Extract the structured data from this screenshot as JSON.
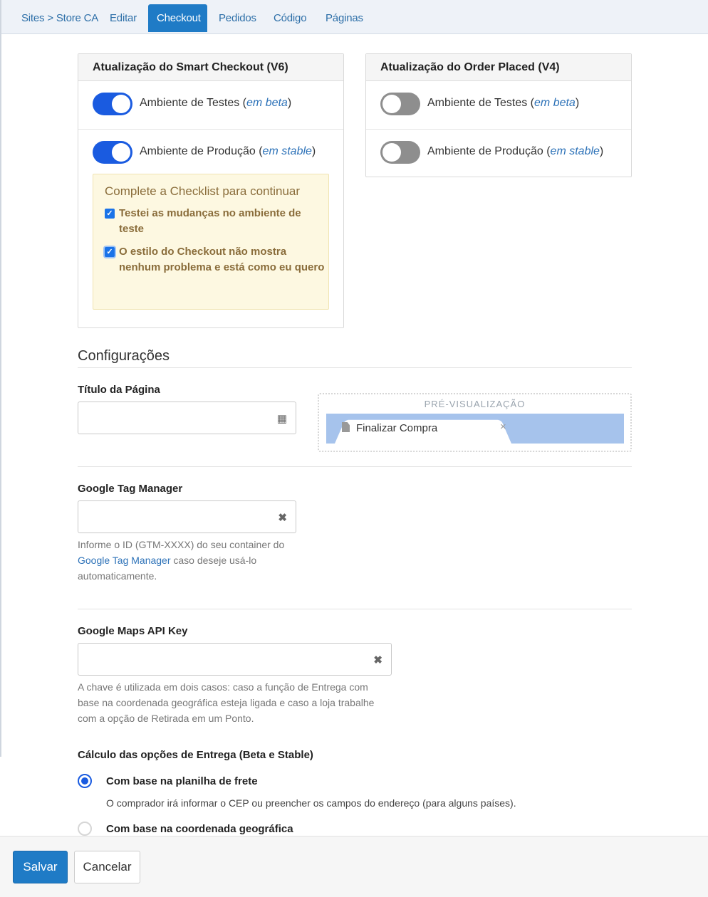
{
  "nav": {
    "breadcrumb": "Sites > Store CA",
    "tabs": [
      "Editar",
      "Checkout",
      "Pedidos",
      "Código",
      "Páginas"
    ],
    "active_tab": "Checkout"
  },
  "smart_checkout": {
    "title": "Atualização do Smart Checkout (V6)",
    "test_label": "Ambiente de Testes (",
    "test_tag": "em beta",
    "prod_label": "Ambiente de Produção (",
    "prod_tag": "em stable",
    "close_paren": ")",
    "test_on": true,
    "prod_on": true,
    "checklist_title": "Complete a Checklist para continuar",
    "check1": "Testei as mudanças no ambiente de teste",
    "check2": "O estilo do Checkout não mostra nenhum problema e está como eu quero"
  },
  "order_placed": {
    "title": "Atualização do Order Placed (V4)",
    "test_label": "Ambiente de Testes (",
    "test_tag": "em beta",
    "prod_label": "Ambiente de Produção (",
    "prod_tag": "em stable",
    "close_paren": ")",
    "test_on": false,
    "prod_on": false
  },
  "config": {
    "section_title": "Configurações",
    "page_title_label": "Título da Página",
    "page_title_value": "",
    "preview_label": "PRÉ-VISUALIZAÇÃO",
    "preview_tab_title": "Finalizar Compra",
    "tab_close": "×",
    "gtm_label": "Google Tag Manager",
    "gtm_value": "",
    "gtm_help_pre": "Informe o ID (GTM-XXXX) do seu container do ",
    "gtm_help_link": "Google Tag Manager",
    "gtm_help_post": " caso deseje usá-lo automaticamente.",
    "maps_label": "Google Maps API Key",
    "maps_value": "",
    "maps_help": "A chave é utilizada em dois casos: caso a função de Entrega com base na coordenada geográfica esteja ligada e caso a loja trabalhe com a opção de Retirada em um Ponto.",
    "shipping_label": "Cálculo das opções de Entrega (Beta e Stable)",
    "opt1_label": "Com base na planilha de frete",
    "opt1_help": "O comprador irá informar o CEP ou preencher os campos do endereço (para alguns países).",
    "opt2_label": "Com base na coordenada geográfica",
    "selected_option": 1
  },
  "footer": {
    "save": "Salvar",
    "cancel": "Cancelar"
  }
}
